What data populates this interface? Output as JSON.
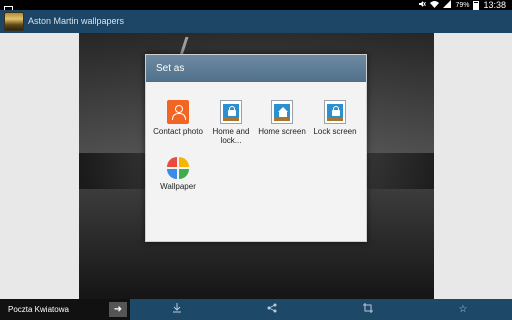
{
  "status": {
    "battery": "79%",
    "time": "13:38"
  },
  "app": {
    "title": "Aston Martin wallpapers"
  },
  "dialog": {
    "title": "Set as",
    "options": [
      {
        "label": "Contact photo",
        "icon": "contact-icon"
      },
      {
        "label": "Home and lock...",
        "icon": "home-lock-icon"
      },
      {
        "label": "Home screen",
        "icon": "home-screen-icon"
      },
      {
        "label": "Lock screen",
        "icon": "lock-screen-icon"
      },
      {
        "label": "Wallpaper",
        "icon": "photos-icon"
      }
    ]
  },
  "bottom_bar": {
    "ad_text": "Poczta Kwiatowa",
    "icons": [
      "download-icon",
      "share-icon",
      "crop-icon",
      "star-icon"
    ]
  }
}
